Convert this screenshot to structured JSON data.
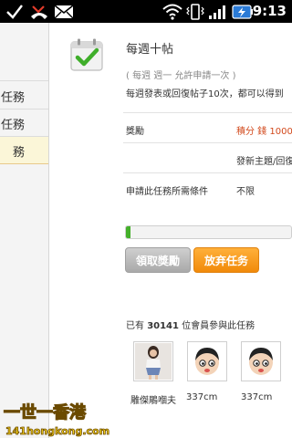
{
  "status_bar": {
    "time": "9:13",
    "icons": [
      "check-icon",
      "missed-call-icon",
      "mail-icon",
      "wifi-icon",
      "vibrate-icon",
      "signal-icon",
      "battery-icon"
    ]
  },
  "sidebar": {
    "items": [
      {
        "label": ""
      },
      {
        "label": "任務"
      },
      {
        "label": "任務"
      },
      {
        "label": "務",
        "active": true
      }
    ]
  },
  "task": {
    "icon": "calendar-check-icon",
    "title": "每週十帖",
    "subtitle": "( 每週 週一 允許申請一次 )",
    "description": "每週發表或回復帖子10次，都可以得到",
    "reward_label": "獎勵",
    "reward_value": "積分 錢 1000",
    "reward_detail": "發新主題/回復",
    "condition_label": "申請此任務所需條件",
    "condition_value": "不限",
    "progress_percent": 3,
    "buttons": {
      "claim": "領取獎勵",
      "abandon": "放弃任务"
    },
    "participants": {
      "prefix": "已有",
      "count": "30141",
      "suffix": "位會員參與此任務"
    },
    "members": [
      {
        "name": "雕傑鵰嗰夫"
      },
      {
        "name": "337cm"
      },
      {
        "name": "337cm"
      }
    ]
  },
  "watermark": {
    "line1": "一世一香港",
    "line2": "141hongkong.com"
  },
  "colors": {
    "accent_orange": "#f18a0a",
    "reward_red": "#d2491c",
    "progress_green": "#44b02a"
  }
}
